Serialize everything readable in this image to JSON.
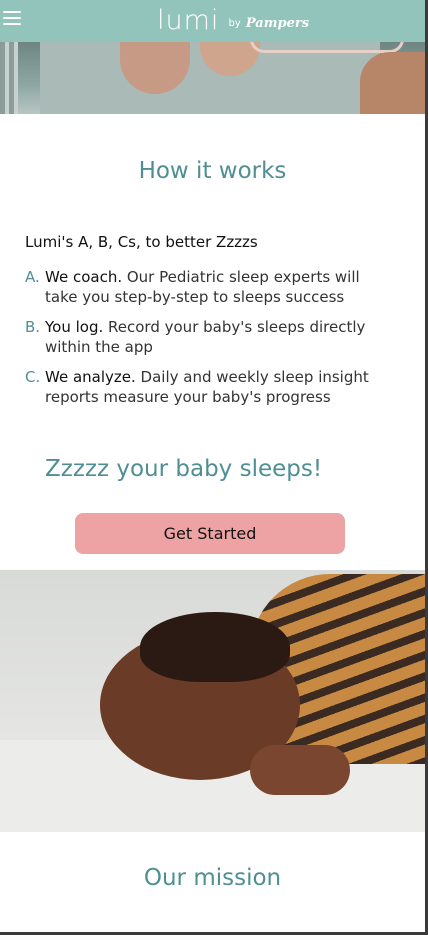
{
  "header": {
    "logo_word": "lumi",
    "logo_by": "by",
    "logo_brand": "Pampers"
  },
  "how_it_works": {
    "title": "How it works",
    "intro": "Lumi's A, B, Cs, to better Zzzzs",
    "steps": [
      {
        "letter": "A.",
        "bold": "We coach.",
        "text": " Our Pediatric sleep experts will take you step-by-step to sleeps success"
      },
      {
        "letter": "B.",
        "bold": "You log.",
        "text": " Record your baby's sleeps directly within the app"
      },
      {
        "letter": "C.",
        "bold": "We analyze.",
        "text": " Daily and weekly sleep insight reports measure your baby's progress"
      }
    ]
  },
  "cta_section": {
    "title": "Zzzzz your baby sleeps!",
    "button_label": "Get Started"
  },
  "mission": {
    "title": "Our mission"
  },
  "colors": {
    "header_bg": "#93c4bb",
    "accent_teal": "#4f8f92",
    "cta_pink": "#eda3a3"
  },
  "icons": [
    "hamburger-menu-icon"
  ]
}
